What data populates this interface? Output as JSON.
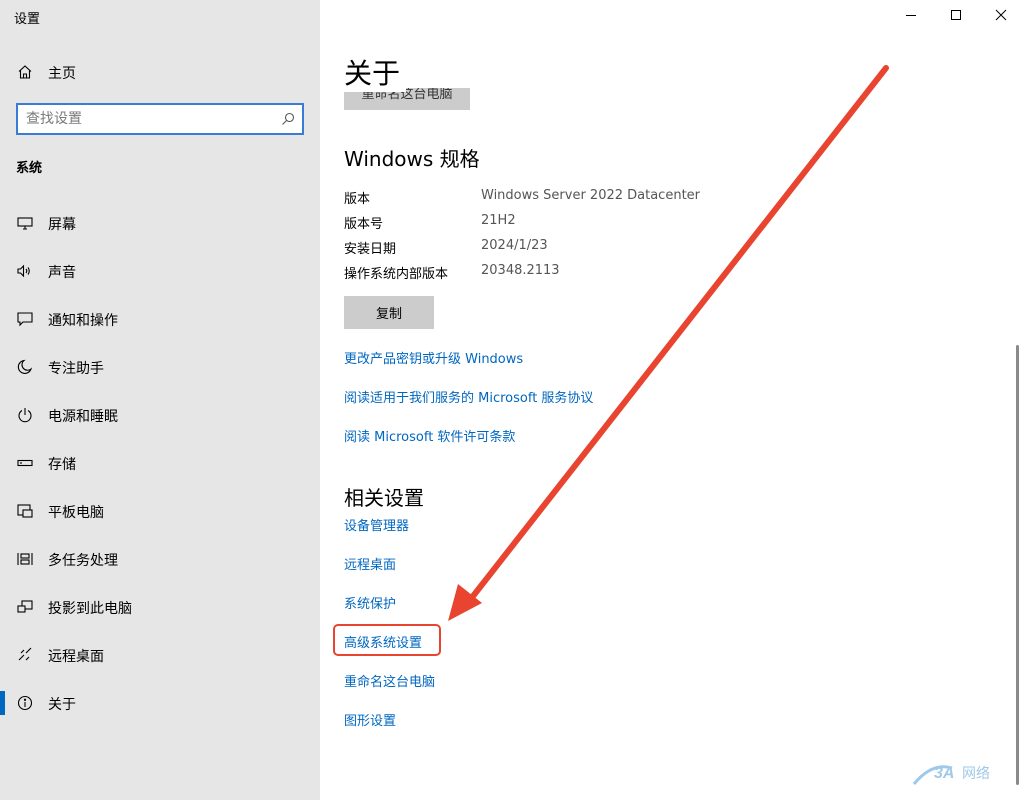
{
  "window": {
    "title": "设置"
  },
  "sidebar": {
    "home_label": "主页",
    "search_placeholder": "查找设置",
    "section_title": "系统",
    "items": [
      {
        "label": "屏幕",
        "icon": "display-icon"
      },
      {
        "label": "声音",
        "icon": "speaker-icon"
      },
      {
        "label": "通知和操作",
        "icon": "notification-icon"
      },
      {
        "label": "专注助手",
        "icon": "moon-icon"
      },
      {
        "label": "电源和睡眠",
        "icon": "power-icon"
      },
      {
        "label": "存储",
        "icon": "storage-icon"
      },
      {
        "label": "平板电脑",
        "icon": "tablet-icon"
      },
      {
        "label": "多任务处理",
        "icon": "multitask-icon"
      },
      {
        "label": "投影到此电脑",
        "icon": "project-icon"
      },
      {
        "label": "远程桌面",
        "icon": "remote-desktop-icon"
      },
      {
        "label": "关于",
        "icon": "info-icon",
        "active": true
      }
    ]
  },
  "main": {
    "title": "关于",
    "rename_button_partial": "重命名这台电脑",
    "windows_spec": {
      "heading": "Windows 规格",
      "rows": [
        {
          "key": "版本",
          "value": "Windows Server 2022 Datacenter"
        },
        {
          "key": "版本号",
          "value": "21H2"
        },
        {
          "key": "安装日期",
          "value": "2024/1/23"
        },
        {
          "key": "操作系统内部版本",
          "value": "20348.2113"
        }
      ],
      "copy_label": "复制"
    },
    "links": [
      "更改产品密钥或升级 Windows",
      "阅读适用于我们服务的 Microsoft 服务协议",
      "阅读 Microsoft 软件许可条款"
    ],
    "related": {
      "heading": "相关设置",
      "links": [
        "设备管理器",
        "远程桌面",
        "系统保护",
        "高级系统设置",
        "重命名这台电脑",
        "图形设置"
      ],
      "highlighted": "高级系统设置"
    }
  },
  "colors": {
    "accent": "#0067c0",
    "annotation": "#e8442f",
    "sidebar_bg": "#e6e6e6"
  }
}
